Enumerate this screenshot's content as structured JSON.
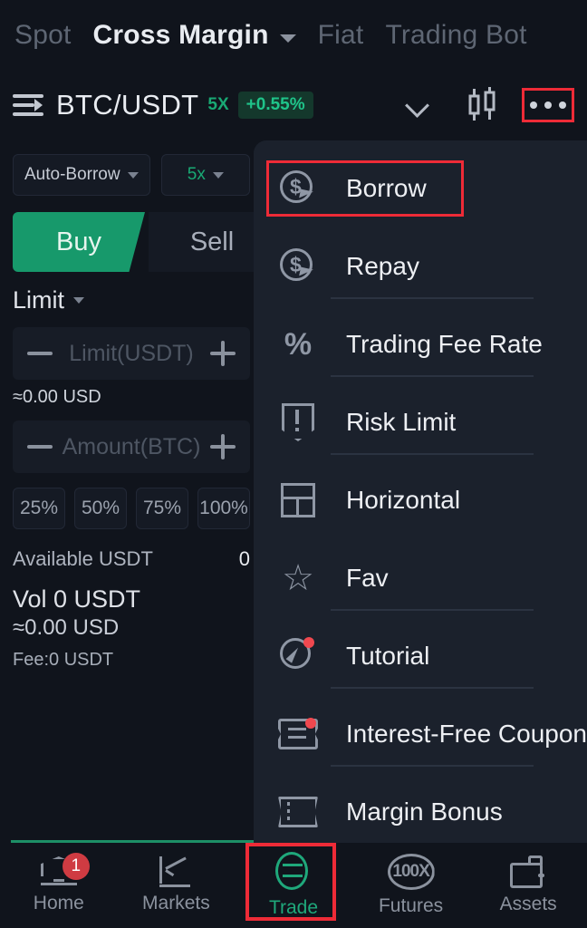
{
  "top_tabs": [
    {
      "label": "Spot",
      "active": false
    },
    {
      "label": "Cross Margin",
      "active": true
    },
    {
      "label": "Fiat",
      "active": false
    },
    {
      "label": "Trading Bot",
      "active": false
    }
  ],
  "pair_row": {
    "list_icon": "list-arrow-icon",
    "pair": "BTC/USDT",
    "leverage": "5X",
    "change": "+0.55%",
    "chevron": "chevron-down-icon",
    "chart_icon": "candlestick-icon",
    "more_icon": "more-dots-icon"
  },
  "trade_form": {
    "auto_borrow": "Auto-Borrow",
    "leverage": "5x",
    "buy_label": "Buy",
    "sell_label": "Sell",
    "order_type": "Limit",
    "price_placeholder": "Limit(USDT)",
    "price_approx": "≈0.00 USD",
    "amount_placeholder": "Amount(BTC)",
    "percent_buttons": [
      "25%",
      "50%",
      "75%",
      "100%"
    ],
    "available_label": "Available USDT",
    "available_value": "0",
    "vol_line": "Vol 0 USDT",
    "vol_approx": "≈0.00 USD",
    "fee_line": "Fee:0 USDT"
  },
  "menu": {
    "items": [
      {
        "label": "Borrow",
        "icon": "dollar-bubble-icon",
        "badge": false,
        "separator_below": false,
        "highlighted": true
      },
      {
        "label": "Repay",
        "icon": "dollar-bubble-icon",
        "badge": false,
        "separator_below": true,
        "highlighted": false
      },
      {
        "label": "Trading Fee Rate",
        "icon": "percent-icon",
        "badge": false,
        "separator_below": true,
        "highlighted": false
      },
      {
        "label": "Risk Limit",
        "icon": "shield-alert-icon",
        "badge": false,
        "separator_below": true,
        "highlighted": false
      },
      {
        "label": "Horizontal",
        "icon": "layout-icon",
        "badge": false,
        "separator_below": false,
        "highlighted": false
      },
      {
        "label": "Fav",
        "icon": "star-icon",
        "badge": false,
        "separator_below": true,
        "highlighted": false
      },
      {
        "label": "Tutorial",
        "icon": "compass-icon",
        "badge": true,
        "separator_below": true,
        "highlighted": false
      },
      {
        "label": "Interest-Free Coupon",
        "icon": "coupon-icon",
        "badge": true,
        "separator_below": true,
        "highlighted": false
      },
      {
        "label": "Margin Bonus",
        "icon": "margin-bonus-icon",
        "badge": false,
        "separator_below": false,
        "highlighted": false
      }
    ]
  },
  "bottom_nav": [
    {
      "label": "Home",
      "icon": "home-icon",
      "badge": "1",
      "active": false
    },
    {
      "label": "Markets",
      "icon": "markets-icon",
      "badge": null,
      "active": false
    },
    {
      "label": "Trade",
      "icon": "trade-icon",
      "badge": null,
      "active": true
    },
    {
      "label": "Futures",
      "icon": "futures-icon",
      "badge": null,
      "active": false
    },
    {
      "label": "Assets",
      "icon": "assets-icon",
      "badge": null,
      "active": false
    }
  ],
  "futures_icon_text": "100X",
  "colors": {
    "background": "#10141c",
    "menu_bg": "#1b212c",
    "accent_green": "#19a974",
    "highlight_red": "#ee2b37",
    "text_primary": "#e9ecf1",
    "text_muted": "#8b929e"
  }
}
